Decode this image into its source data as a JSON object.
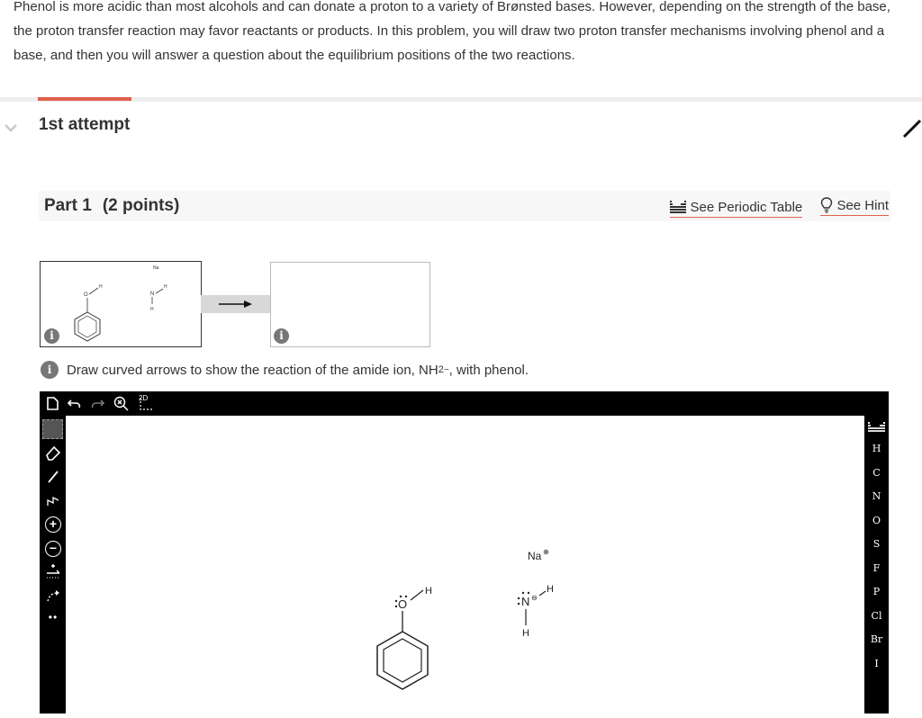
{
  "intro": {
    "text": "Phenol is more acidic than most alcohols and can donate a proton to a variety of Brønsted bases. However, depending on the strength of the base, the proton transfer reaction may favor reactants or products. In this problem, you will draw two proton transfer mechanisms involving phenol and a base, and then you will answer a question about the equilibrium positions of the two reactions."
  },
  "attempt": {
    "label": "1st attempt"
  },
  "part": {
    "title": "Part 1",
    "points": "(2 points)",
    "periodic_table_label": "See Periodic Table",
    "hint_label": "See Hint"
  },
  "instruction": {
    "before": "Draw curved arrows to show the reaction of the amide ion, NH",
    "sub": "2",
    "sup": "−",
    "after": ", with phenol."
  },
  "info_glyph": "i",
  "molecules": {
    "na": "Na",
    "na_charge": "⊕",
    "o": "O",
    "n": "N",
    "h": "H",
    "n_charge": "⊖"
  },
  "elements": [
    "H",
    "C",
    "N",
    "O",
    "S",
    "F",
    "P",
    "Cl",
    "Br",
    "I"
  ],
  "toolbar": {
    "twod_label": "2D"
  },
  "left_tools": {
    "plus": "+",
    "minus": "−",
    "dots": "••"
  }
}
